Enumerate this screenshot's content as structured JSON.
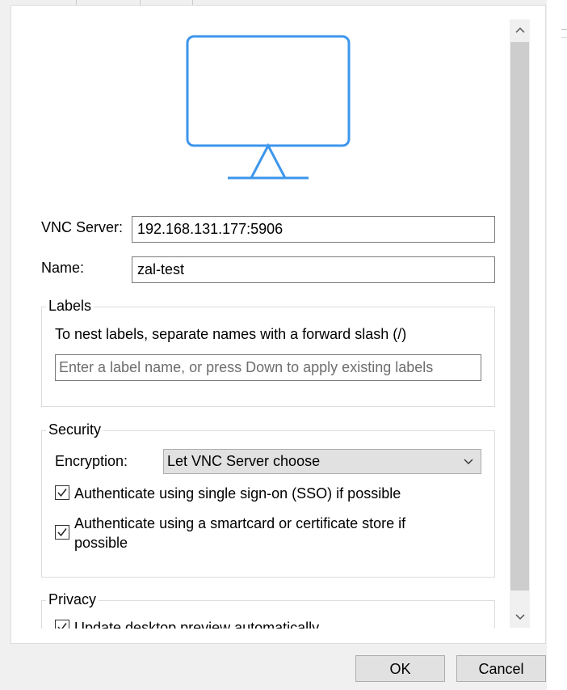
{
  "preview": {
    "icon": "monitor-icon",
    "accent_color": "#3d96ec"
  },
  "connection": {
    "vnc_server_label": "VNC Server:",
    "vnc_server_value": "192.168.131.177:5906",
    "name_label": "Name:",
    "name_value": "zal-test"
  },
  "labels": {
    "title": "Labels",
    "hint": "To nest labels, separate names with a forward slash (/)",
    "input_placeholder": "Enter a label name, or press Down to apply existing labels"
  },
  "security": {
    "title": "Security",
    "encryption_label": "Encryption:",
    "encryption_value": "Let VNC Server choose",
    "sso_label": "Authenticate using single sign-on (SSO) if possible",
    "sso_checked": true,
    "smartcard_label": "Authenticate using a smartcard or certificate store if possible",
    "smartcard_checked": true
  },
  "privacy": {
    "title": "Privacy",
    "update_preview_label": "Update desktop preview automatically",
    "update_preview_checked": true
  },
  "buttons": {
    "ok": "OK",
    "cancel": "Cancel"
  }
}
